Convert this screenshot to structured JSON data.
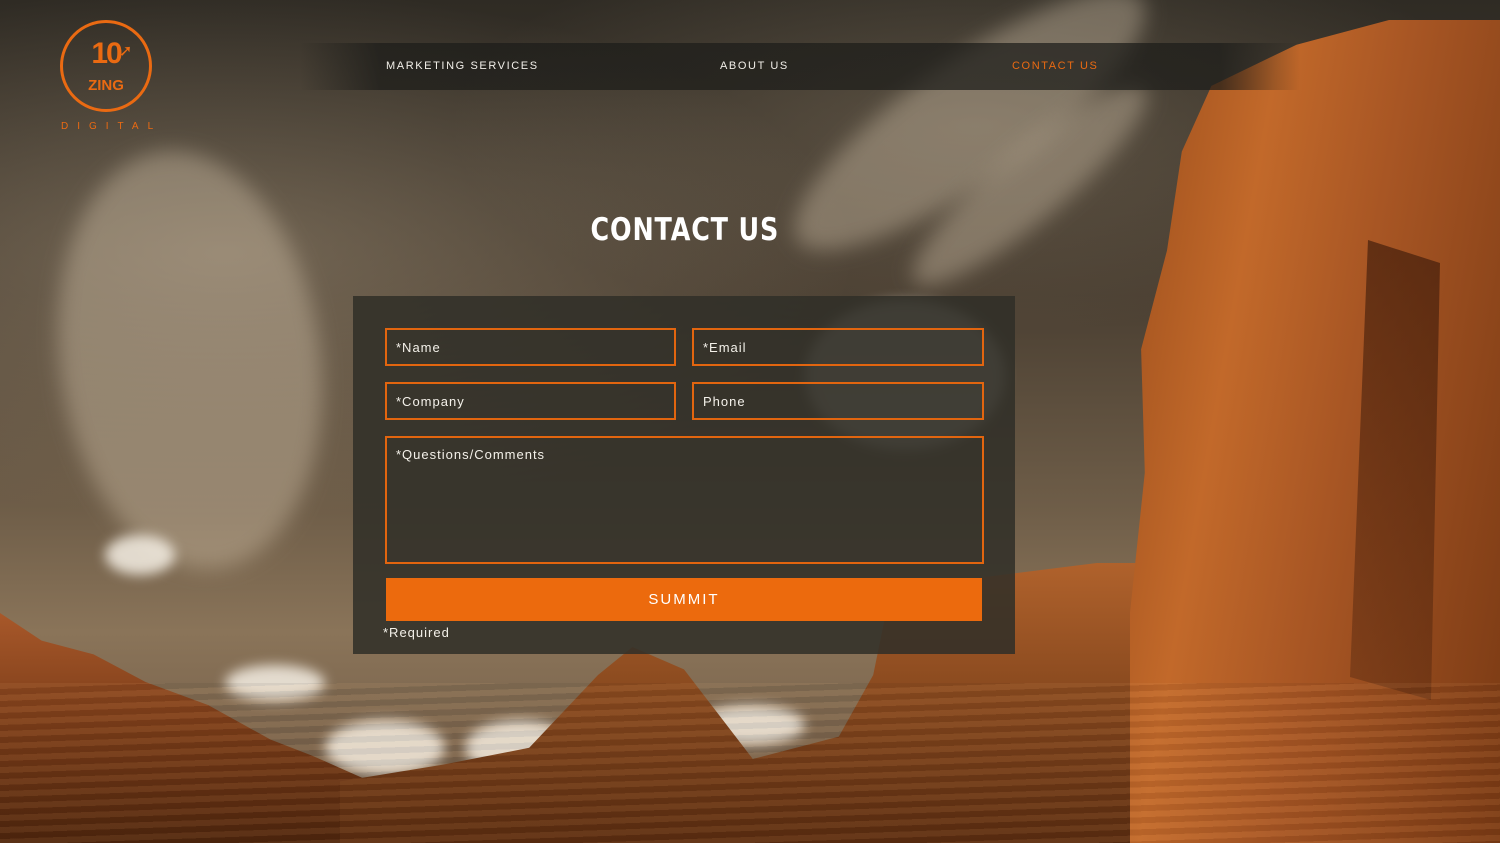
{
  "brand": {
    "logo_number": "10",
    "logo_word": "ZING",
    "logo_subtitle": "DIGITAL",
    "accent_color": "#ea6a12"
  },
  "nav": {
    "items": [
      {
        "label": "MARKETING SERVICES",
        "active": false
      },
      {
        "label": "ABOUT US",
        "active": false
      },
      {
        "label": "CONTACT US",
        "active": true
      }
    ]
  },
  "page": {
    "title": "CONTACT US"
  },
  "form": {
    "name_placeholder": "*Name",
    "email_placeholder": "*Email",
    "company_placeholder": "*Company",
    "phone_placeholder": "Phone",
    "comments_placeholder": "*Questions/Comments",
    "submit_label": "SUMMIT",
    "required_note": "*Required",
    "button_color": "#ec6a0d"
  }
}
